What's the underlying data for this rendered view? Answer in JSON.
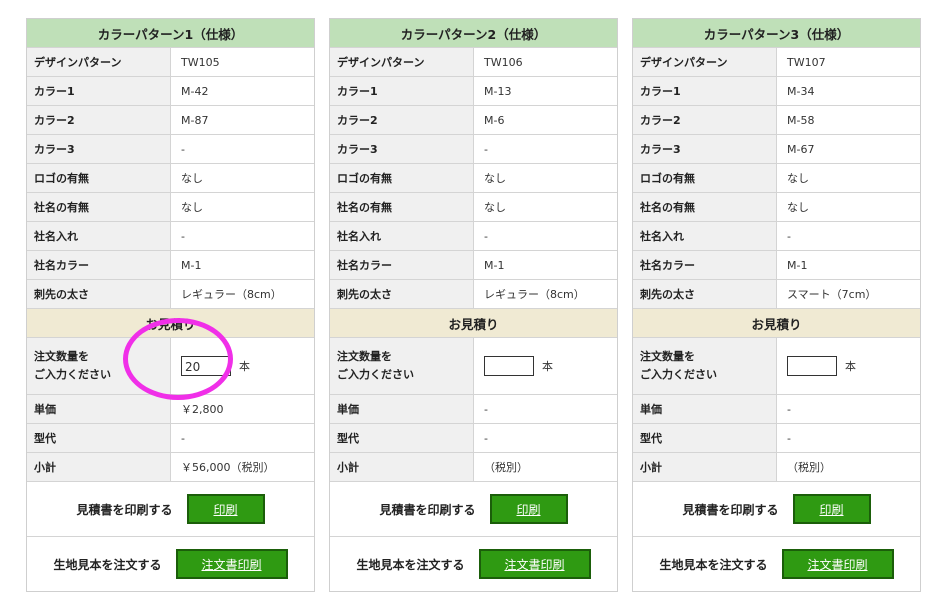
{
  "labels": {
    "design": "デザインパターン",
    "color1": "カラー1",
    "color2": "カラー2",
    "color3": "カラー3",
    "logo": "ロゴの有無",
    "company_name_present": "社名の有無",
    "company_name_insert": "社名入れ",
    "company_name_color": "社名カラー",
    "tip_thickness": "刺先の太さ",
    "quote_header": "お見積り",
    "qty_line1": "注文数量を",
    "qty_line2": "ご入力ください",
    "unit_price": "単価",
    "mold_fee": "型代",
    "subtotal": "小計",
    "qty_unit": "本",
    "print_quote": "見積書を印刷する",
    "print_button": "印刷",
    "order_sample": "生地見本を注文する",
    "order_button": "注文書印刷"
  },
  "panels": [
    {
      "title": "カラーパターン1（仕様）",
      "design": "TW105",
      "color1": "M-42",
      "color2": "M-87",
      "color3": "-",
      "logo": "なし",
      "company_name_present": "なし",
      "company_name_insert": "-",
      "company_name_color": "M-1",
      "tip_thickness": "レギュラー（8cm）",
      "qty_value": "20",
      "unit_price": "￥2,800",
      "mold_fee": "-",
      "subtotal": "￥56,000（税別）"
    },
    {
      "title": "カラーパターン2（仕様）",
      "design": "TW106",
      "color1": "M-13",
      "color2": "M-6",
      "color3": "-",
      "logo": "なし",
      "company_name_present": "なし",
      "company_name_insert": "-",
      "company_name_color": "M-1",
      "tip_thickness": "レギュラー（8cm）",
      "qty_value": "",
      "unit_price": "-",
      "mold_fee": "-",
      "subtotal": "（税別）"
    },
    {
      "title": "カラーパターン3（仕様）",
      "design": "TW107",
      "color1": "M-34",
      "color2": "M-58",
      "color3": "M-67",
      "logo": "なし",
      "company_name_present": "なし",
      "company_name_insert": "-",
      "company_name_color": "M-1",
      "tip_thickness": "スマート（7cm）",
      "qty_value": "",
      "unit_price": "-",
      "mold_fee": "-",
      "subtotal": "（税別）"
    }
  ],
  "colors": {
    "header_green": "#bfe0b8",
    "quote_beige": "#f0ead3",
    "button_green": "#2f9a12",
    "highlight_magenta": "#f02fe8"
  }
}
